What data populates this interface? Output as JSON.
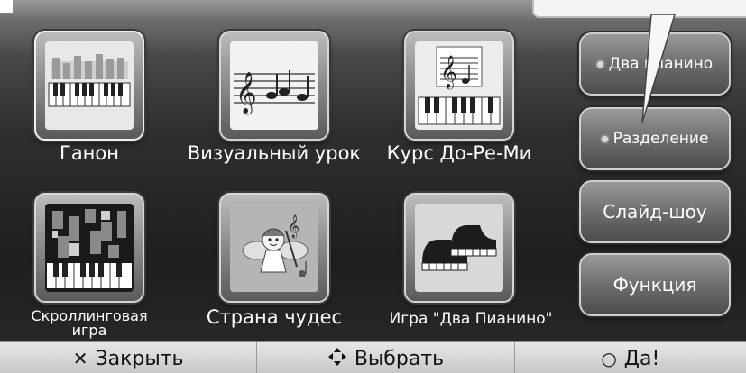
{
  "tiles": [
    {
      "label": "Ганон",
      "icon": "piano-keys-icon"
    },
    {
      "label": "Визуальный урок",
      "icon": "music-staff-icon"
    },
    {
      "label": "Курс До-Ре-Ми",
      "icon": "treble-clef-keyboard-icon"
    },
    {
      "label_line1": "Скроллинговая",
      "label_line2": "игра",
      "icon": "scrolling-notes-icon"
    },
    {
      "label": "Страна чудес",
      "icon": "fairy-icon"
    },
    {
      "label": "Игра \"Два Пианино\"",
      "icon": "two-pianos-icon"
    }
  ],
  "side_buttons": [
    {
      "label": "Два пианино"
    },
    {
      "label": "Разделение"
    },
    {
      "label": "Слайд-шоу"
    },
    {
      "label": "Функция"
    }
  ],
  "bottom_bar": {
    "close_label": "Закрыть",
    "close_icon": "close-icon",
    "select_label": "Выбрать",
    "select_icon": "dpad-icon",
    "ok_label": "Да!",
    "ok_icon": "circle-icon"
  },
  "colors": {
    "background": "#2f2f2f",
    "tile": "#8e8e8e",
    "text": "#ffffff",
    "bar": "#d6d6d6"
  }
}
